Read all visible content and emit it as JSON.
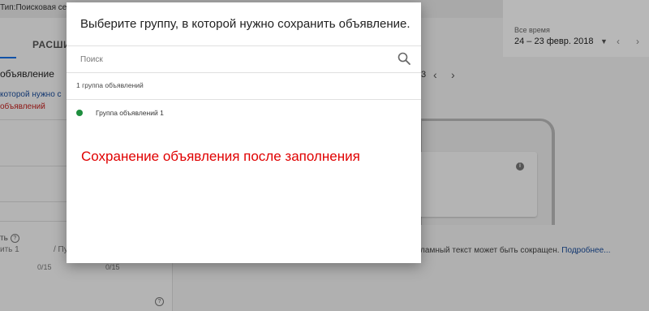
{
  "background": {
    "type_label": "Тип:Поисковая се",
    "tab_expand": "РАСШИ",
    "ad_heading": "объявление",
    "help_line1": "которой нужно с",
    "help_line2": "объявлений",
    "field_label": "ть",
    "field_placeholder": "ить 1",
    "field_placeholder2": "/ Пу",
    "counter1": "0/15",
    "counter2": "0/15",
    "date_label": "Все время",
    "date_value": "24 – 23 февр. 2018",
    "preview_nav_num": "3",
    "preview_note": "екламный текст может быть сокращен.",
    "preview_link": "Подробнее..."
  },
  "dialog": {
    "title": "Выберите группу, в которой нужно сохранить объявление.",
    "search_placeholder": "Поиск",
    "group_count": "1 группа объявлений",
    "groups": [
      {
        "name": "Группа объявлений 1",
        "status_color": "#1e8e3e"
      }
    ]
  },
  "annotation": "Сохранение объявления после заполнения"
}
